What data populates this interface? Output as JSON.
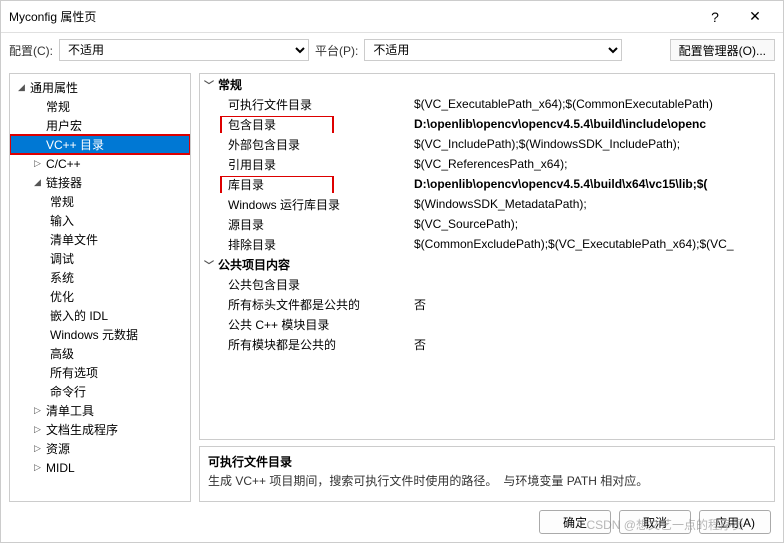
{
  "title": "Myconfig 属性页",
  "toolbar": {
    "config_label": "配置(C):",
    "config_value": "不适用",
    "platform_label": "平台(P):",
    "platform_value": "不适用",
    "config_mgr": "配置管理器(O)..."
  },
  "tree": {
    "root": "通用属性",
    "items_l1": [
      "常规",
      "用户宏",
      "VC++ 目录",
      "C/C++",
      "链接器"
    ],
    "linker_children": [
      "常规",
      "输入",
      "清单文件",
      "调试",
      "系统",
      "优化",
      "嵌入的 IDL",
      "Windows 元数据",
      "高级",
      "所有选项",
      "命令行"
    ],
    "items_after_linker": [
      "清单工具",
      "文档生成程序",
      "资源",
      "MIDL"
    ]
  },
  "grid": {
    "group1": "常规",
    "group2": "公共项目内容",
    "rows": [
      {
        "label": "可执行文件目录",
        "value": "$(VC_ExecutablePath_x64);$(CommonExecutablePath)"
      },
      {
        "label": "包含目录",
        "value": "D:\\openlib\\opencv\\opencv4.5.4\\build\\include\\openc",
        "bold": true,
        "hl": true
      },
      {
        "label": "外部包含目录",
        "value": "$(VC_IncludePath);$(WindowsSDK_IncludePath);"
      },
      {
        "label": "引用目录",
        "value": "$(VC_ReferencesPath_x64);"
      },
      {
        "label": "库目录",
        "value": "D:\\openlib\\opencv\\opencv4.5.4\\build\\x64\\vc15\\lib;$(",
        "bold": true,
        "hl": true
      },
      {
        "label": "Windows 运行库目录",
        "value": "$(WindowsSDK_MetadataPath);"
      },
      {
        "label": "源目录",
        "value": "$(VC_SourcePath);"
      },
      {
        "label": "排除目录",
        "value": "$(CommonExcludePath);$(VC_ExecutablePath_x64);$(VC_"
      }
    ],
    "rows2": [
      {
        "label": "公共包含目录",
        "value": ""
      },
      {
        "label": "所有标头文件都是公共的",
        "value": "否"
      },
      {
        "label": "公共 C++ 模块目录",
        "value": ""
      },
      {
        "label": "所有模块都是公共的",
        "value": "否"
      }
    ]
  },
  "desc": {
    "title": "可执行文件目录",
    "body": "生成 VC++ 项目期间，搜索可执行文件时使用的路径。　与环境变量 PATH 相对应。"
  },
  "footer": {
    "ok": "确定",
    "cancel": "取消",
    "apply": "应用(A)"
  },
  "watermark": "CSDN @想文艺一点的程序员"
}
